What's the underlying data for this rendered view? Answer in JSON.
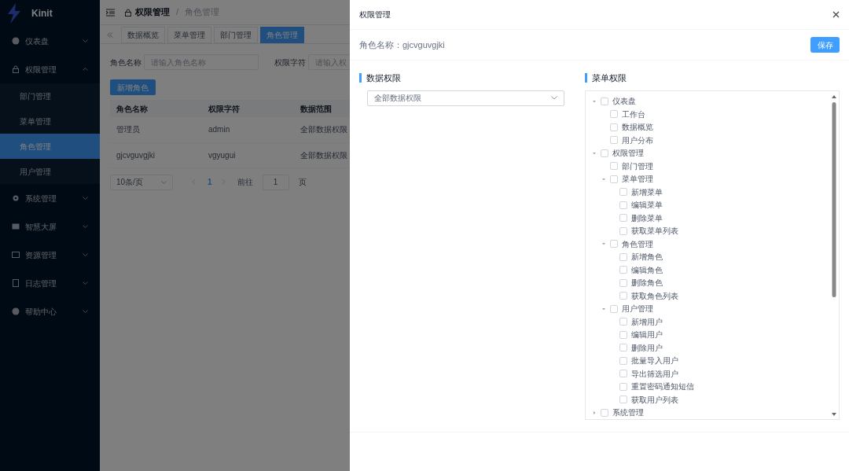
{
  "app": {
    "name": "Kinit"
  },
  "sidebar": {
    "items": [
      {
        "label": "仪表盘",
        "expanded": false
      },
      {
        "label": "权限管理",
        "expanded": true,
        "children": [
          {
            "label": "部门管理",
            "selected": false
          },
          {
            "label": "菜单管理",
            "selected": false
          },
          {
            "label": "角色管理",
            "selected": true
          },
          {
            "label": "用户管理",
            "selected": false
          }
        ]
      },
      {
        "label": "系统管理",
        "expanded": false
      },
      {
        "label": "智慧大屏",
        "expanded": false
      },
      {
        "label": "资源管理",
        "expanded": false
      },
      {
        "label": "日志管理",
        "expanded": false
      },
      {
        "label": "帮助中心",
        "expanded": false
      }
    ]
  },
  "breadcrumb": {
    "items": [
      "权限管理",
      "角色管理"
    ],
    "separator": "/"
  },
  "tabs": [
    {
      "label": "数据概览",
      "selected": false
    },
    {
      "label": "菜单管理",
      "selected": false
    },
    {
      "label": "部门管理",
      "selected": false
    },
    {
      "label": "角色管理",
      "selected": true
    }
  ],
  "search_form": [
    {
      "label": "角色名称",
      "placeholder": "请输入角色名称"
    },
    {
      "label": "权限字符",
      "placeholder": "请输入权"
    }
  ],
  "add_button": "新增角色",
  "table": {
    "columns": [
      "角色名称",
      "权限字符",
      "数据范围"
    ],
    "rows": [
      [
        "管理员",
        "admin",
        "全部数据权限"
      ],
      [
        "gjcvguvgjki",
        "vgyugui",
        "全部数据权限"
      ]
    ]
  },
  "pagination": {
    "page_size": "10条/页",
    "current": "1",
    "goto_label": "前往",
    "goto_value": "1",
    "goto_suffix": "页"
  },
  "drawer": {
    "title": "权限管理",
    "role_name": "角色名称：gjcvguvgjki",
    "save_button": "保存",
    "data_section": {
      "title": "数据权限",
      "select_value": "全部数据权限"
    },
    "menu_section": {
      "title": "菜单权限",
      "tree": [
        {
          "label": "仪表盘",
          "checked": false,
          "expanded": true,
          "children": [
            {
              "label": "工作台",
              "checked": false
            },
            {
              "label": "数据概览",
              "checked": false
            },
            {
              "label": "用户分布",
              "checked": false
            }
          ]
        },
        {
          "label": "权限管理",
          "checked": false,
          "expanded": true,
          "children": [
            {
              "label": "部门管理",
              "checked": false
            },
            {
              "label": "菜单管理",
              "checked": false,
              "expanded": true,
              "children": [
                {
                  "label": "新增菜单",
                  "checked": false
                },
                {
                  "label": "编辑菜单",
                  "checked": false
                },
                {
                  "label": "删除菜单",
                  "checked": false
                },
                {
                  "label": "获取菜单列表",
                  "checked": false
                }
              ]
            },
            {
              "label": "角色管理",
              "checked": false,
              "expanded": true,
              "children": [
                {
                  "label": "新增角色",
                  "checked": false
                },
                {
                  "label": "编辑角色",
                  "checked": false
                },
                {
                  "label": "删除角色",
                  "checked": false
                },
                {
                  "label": "获取角色列表",
                  "checked": false
                }
              ]
            },
            {
              "label": "用户管理",
              "checked": false,
              "expanded": true,
              "children": [
                {
                  "label": "新增用户",
                  "checked": false
                },
                {
                  "label": "编辑用户",
                  "checked": false
                },
                {
                  "label": "删除用户",
                  "checked": false
                },
                {
                  "label": "批量导入用户",
                  "checked": false
                },
                {
                  "label": "导出筛选用户",
                  "checked": false
                },
                {
                  "label": "重置密码通知短信",
                  "checked": false
                },
                {
                  "label": "获取用户列表",
                  "checked": false
                }
              ]
            }
          ]
        },
        {
          "label": "系统管理",
          "checked": false,
          "expanded": false
        }
      ]
    }
  }
}
